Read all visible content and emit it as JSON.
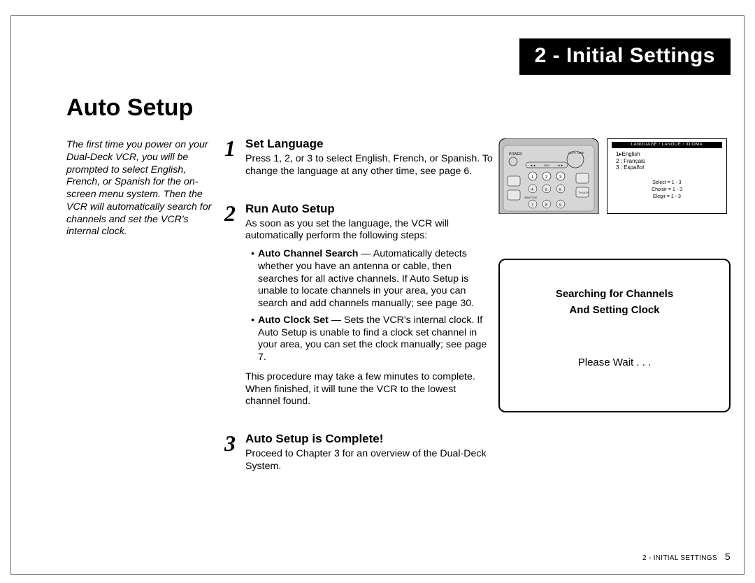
{
  "chapter_banner": "2 - Initial Settings",
  "section_title": "Auto Setup",
  "intro_text": "The first time you power on your Dual-Deck VCR, you will be prompted to select English, French, or Spanish for the on-screen menu system. Then the VCR will automatically search for channels and set the VCR's internal clock.",
  "steps": [
    {
      "num": "1",
      "title": "Set Language",
      "body": "Press 1, 2, or 3 to select English, French, or Spanish. To change the language at any other time, see page 6."
    },
    {
      "num": "2",
      "title": "Run Auto Setup",
      "lead": "As soon as you set the language, the VCR will automatically perform the following steps:",
      "bullets": [
        {
          "label": "Auto Channel Search",
          "text": " — Automatically detects whether you have an antenna or cable, then searches for all active channels. If Auto Setup is unable to locate channels in your area, you can search and add channels manually; see page 30."
        },
        {
          "label": "Auto Clock Set",
          "text": " — Sets the VCR's internal clock. If Auto Setup is unable to find a clock set channel in your area, you can set the clock manually; see page 7."
        }
      ],
      "tail": "This procedure may take a few minutes to complete. When finished, it will tune the VCR to the lowest channel found."
    },
    {
      "num": "3",
      "title": "Auto Setup is Complete!",
      "body": "Proceed to Chapter 3 for an overview of the Dual-Deck System."
    }
  ],
  "osd_lang": {
    "header": "LANGUAGE / LANGUE / IDIOMA",
    "items": [
      "1▸English",
      "2 : Français",
      "3 : Español"
    ],
    "select_lines": [
      "Select = 1 - 3",
      "Choisir = 1 - 3",
      "Elegir = 1 - 3"
    ]
  },
  "searching": {
    "line1": "Searching for Channels",
    "line2": "And Setting Clock",
    "wait": "Please Wait . . ."
  },
  "footer": {
    "label": "2 - INITIAL SETTINGS",
    "page": "5"
  }
}
